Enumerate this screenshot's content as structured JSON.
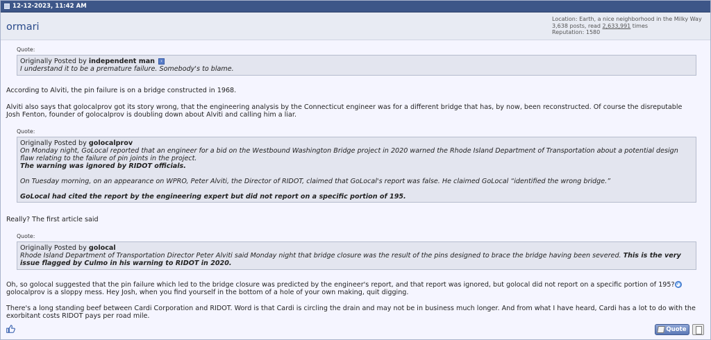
{
  "header": {
    "datetime": "12-12-2023, 11:42 AM"
  },
  "user": {
    "name": "ormari",
    "location": "Location: Earth, a nice neighborhood in the Milky Way",
    "posts_prefix": "3,638 posts, read ",
    "read_count": "2,633,991",
    "posts_suffix": " times",
    "reputation": "Reputation: 1580"
  },
  "quotes": [
    {
      "label": "Quote:",
      "by_prefix": "Originally Posted by ",
      "author": "independent man",
      "text": "I understand it to be a premature failure. Somebody's to blame."
    },
    {
      "label": "Quote:",
      "by_prefix": "Originally Posted by ",
      "author": "golocalprov",
      "line1": "On Monday night, GoLocal reported that an engineer for a bid on the Westbound Washington Bridge project in 2020 warned the Rhode Island Department of Transportation about a potential design flaw relating to the failure of pin joints in the project.",
      "line2": "The warning was ignored by RIDOT officials.",
      "line3": "On Tuesday morning, on an appearance on WPRO, Peter Alviti, the Director of RIDOT, claimed that GoLocal's report was false. He claimed GoLocal “identified the wrong bridge.”",
      "line4": "GoLocal had cited the report by the engineering expert but did not report on a specific portion of 195."
    },
    {
      "label": "Quote:",
      "by_prefix": "Originally Posted by ",
      "author": "golocal",
      "text_regular": "Rhode Island Department of Transportation Director Peter Alviti said Monday night that bridge closure was the result of the pins designed to brace the bridge having been severed. ",
      "text_bold": "This is the very issue flagged by Culmo in his warning to RIDOT in 2020."
    }
  ],
  "paragraphs": {
    "p1": "According to Alviti, the pin failure is on a bridge constructed in 1968.",
    "p2": "Alviti also says that golocalprov got its story wrong, that the engineering analysis by the Connecticut engineer was for a different bridge that has, by now, been reconstructed. Of course the disreputable Josh Fenton, founder of golocalprov is doubling down about Alviti and calling him a liar.",
    "p3": "Really? The first article said",
    "p4a": "Oh, so golocal suggested that the pin failure which led to the bridge closure was predicted by the engineer's report, and that report was ignored, but golocal did not report on a specific portion of 195?",
    "p4b": "golocalprov is a sloppy mess. Hey Josh, when you find yourself in the bottom of a hole of your own making, quit digging.",
    "p5": "There's a long standing beef between Cardi Corporation and RIDOT. Word is that Cardi is circling the drain and may not be in business much longer. And from what I have heard, Cardi has a lot to do with the exorbitant costs RIDOT pays per road mile."
  },
  "footer": {
    "quote_label": "Quote"
  },
  "icons": {
    "view_post": "arrow-right-icon",
    "smiley": "rolleyes-icon",
    "like": "thumbs-up-icon",
    "multiquote": "multiquote-icon"
  },
  "colors": {
    "header_bg": "#3d5688",
    "username": "#2a4a8a",
    "quote_bg": "#e3e5ef"
  }
}
